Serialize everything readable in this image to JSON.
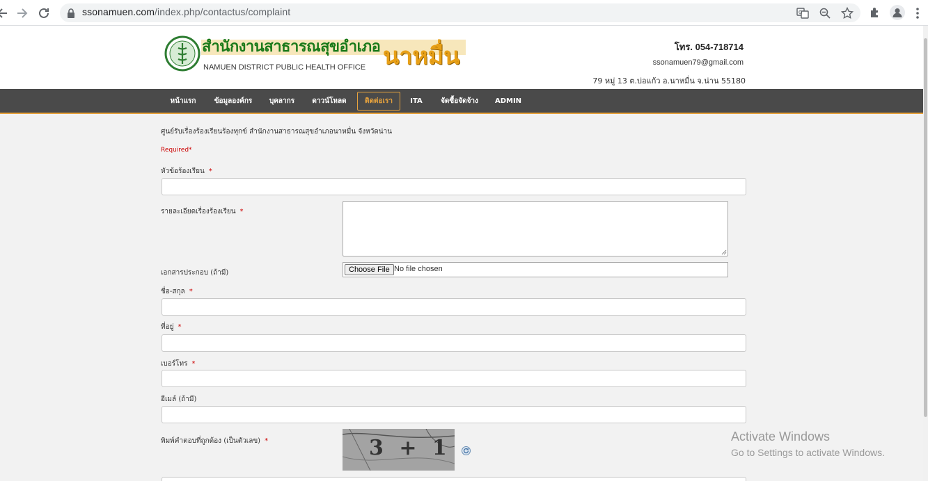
{
  "browser": {
    "url_host": "ssonamuen.com",
    "url_path": "/index.php/contactus/complaint",
    "icons": [
      "back-icon",
      "forward-icon",
      "reload-icon",
      "lock-icon",
      "translate-icon",
      "zoom-icon",
      "star-icon",
      "extensions-icon",
      "profile-icon",
      "menu-icon"
    ]
  },
  "header": {
    "logo_title_th": "สำนักงานสาธารณสุขอำเภอ",
    "logo_name_th": "นาหมื่น",
    "logo_subtitle": "NAMUEN DISTRICT PUBLIC HEALTH OFFICE",
    "phone": "โทร. 054-718714",
    "email": "ssonamuen79@gmail.com",
    "address": "79 หมู่ 13 ต.บ่อแก้ว อ.นาหมื่น จ.น่าน 55180"
  },
  "nav": {
    "items": [
      {
        "label": "หน้าแรก"
      },
      {
        "label": "ข้อมูลองค์กร"
      },
      {
        "label": "บุคลากร"
      },
      {
        "label": "ดาวน์โหลด"
      },
      {
        "label": "ติดต่อเรา",
        "active": true
      },
      {
        "label": "ITA"
      },
      {
        "label": "จัดซื้อจัดจ้าง"
      },
      {
        "label": "ADMIN"
      }
    ]
  },
  "form": {
    "intro": "ศูนย์รับเรื่องร้องเรียนร้องทุกข์ สำนักงานสาธารณสุขอำเภอนาหมื่น จังหวัดน่าน",
    "required_label": "Required*",
    "star": "*",
    "subject_label": "หัวข้อร้องเรียน",
    "detail_label": "รายละเอียดเรื่องร้องเรียน",
    "attachment_label": "เอกสารประกอบ (ถ้ามี)",
    "file_button": "Choose File",
    "file_status": "No file chosen",
    "name_label": "ชื่อ-สกุล",
    "address_label": "ที่อยู่",
    "phone_label": "เบอร์โทร",
    "email_label": "อีเมล์ (ถ้ามี)",
    "captcha_label": "พิมพ์คำตอบที่ถูกต้อง (เป็นตัวเลข)",
    "captcha_text": "3 + 1"
  },
  "watermark": {
    "line1": "Activate Windows",
    "line2": "Go to Settings to activate Windows."
  },
  "colors": {
    "nav_bg": "#4a4a4a",
    "accent": "#e8a33d",
    "required": "#cc0000"
  }
}
